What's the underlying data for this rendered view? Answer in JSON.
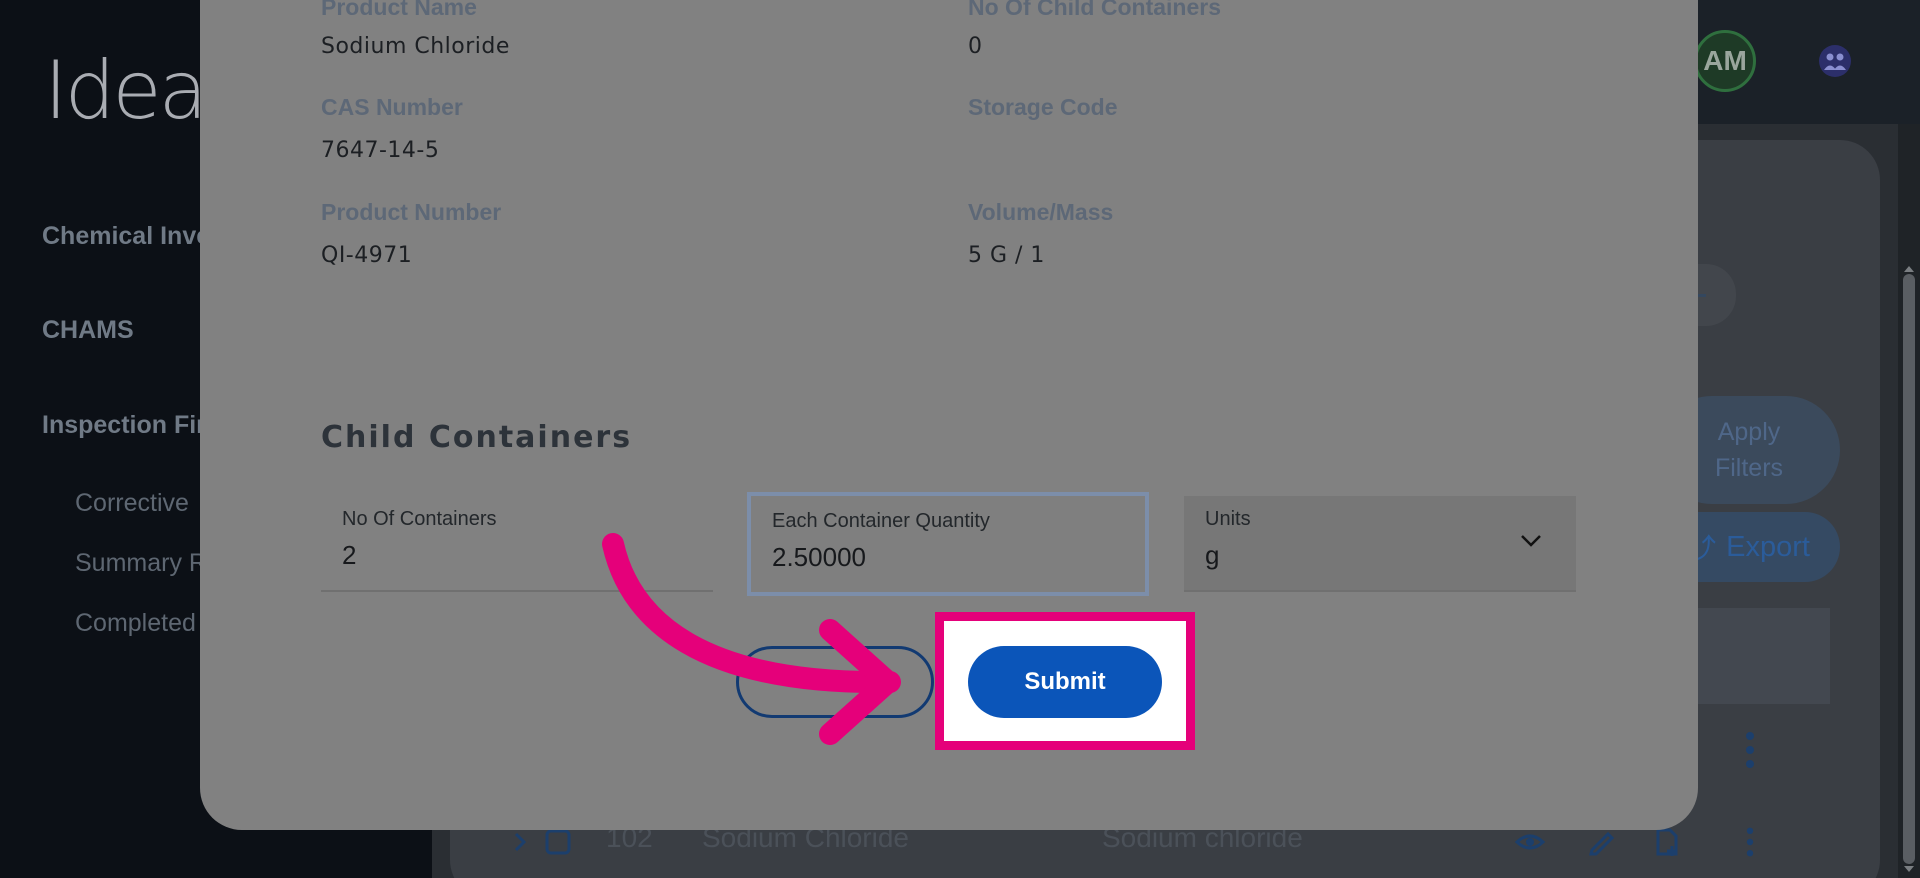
{
  "app": {
    "logo_text": "Idea"
  },
  "sidebar": {
    "items": [
      {
        "label": "Chemical Inve"
      },
      {
        "label": "CHAMS"
      },
      {
        "label": "Inspection Fin"
      }
    ],
    "subitems": [
      {
        "label": "Corrective"
      },
      {
        "label": "Summary R"
      },
      {
        "label": "Completed"
      }
    ]
  },
  "header": {
    "avatar_initials": "AM"
  },
  "background": {
    "apply_filters_line1": "Apply",
    "apply_filters_line2": "Filters",
    "export_label": "Export",
    "row": {
      "id": "102",
      "name": "Sodium Chloride",
      "product": "Sodium chloride"
    }
  },
  "modal": {
    "fields": {
      "product_name_label": "Product Name",
      "product_name_value": "Sodium Chloride",
      "child_containers_label": "No Of Child Containers",
      "child_containers_value": "0",
      "cas_number_label": "CAS Number",
      "cas_number_value": "7647-14-5",
      "storage_code_label": "Storage Code",
      "storage_code_value": "",
      "product_number_label": "Product Number",
      "product_number_value": "QI-4971",
      "volume_mass_label": "Volume/Mass",
      "volume_mass_value": "5 G / 1"
    },
    "child_section_title": "Child Containers",
    "inputs": {
      "containers_label": "No Of Containers",
      "containers_value": "2",
      "quantity_label": "Each Container Quantity",
      "quantity_value": "2.50000",
      "units_label": "Units",
      "units_value": "g"
    },
    "submit_label": "Submit"
  },
  "colors": {
    "highlight": "#e5007a",
    "submit": "#0b55b9"
  },
  "icons": [
    "user-group-icon",
    "chevron-down-icon",
    "kebab-menu-icon",
    "eye-icon",
    "edit-icon",
    "file-add-icon",
    "chevron-right-icon",
    "checkbox-icon",
    "pointer-arrow-icon"
  ]
}
